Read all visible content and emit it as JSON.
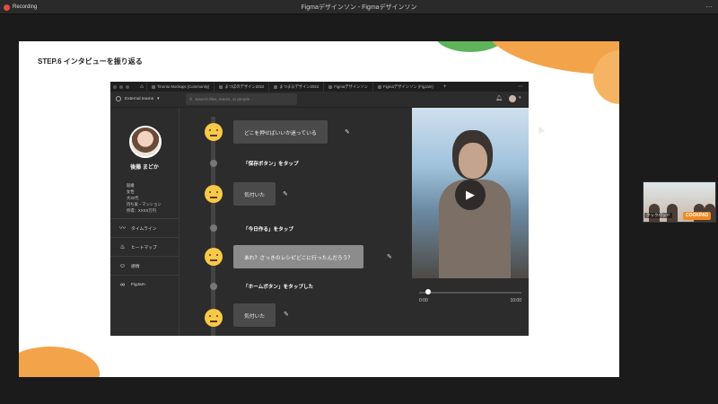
{
  "window": {
    "recording_label": "Recording",
    "title": "Figmaデザインソン - Figmaデザインソン"
  },
  "slide": {
    "title": "STEP.6 インタビューを振り返る"
  },
  "figma": {
    "tabs": [
      "Tinonto Mockups (Community)",
      "まつぼのデザイン2022",
      "まつまるデザイン2022",
      "Figmaデザインソン",
      "Figmaデザインソン (FigJam)"
    ],
    "team_label": "External teams",
    "search_placeholder": "Search files, teams, or people"
  },
  "persona": {
    "name": "後藤 まどか",
    "attributes": [
      "既婚",
      "女性",
      "大30代",
      "持ち家・マンション",
      "所得：XXXX万円"
    ],
    "menu": [
      {
        "label": "タイムライン",
        "icon": "timeline-icon"
      },
      {
        "label": "ヒートマップ",
        "icon": "flame-icon"
      },
      {
        "label": "感情",
        "icon": "smiley-icon"
      },
      {
        "label": "FigJam",
        "icon": "link-icon"
      }
    ]
  },
  "timeline": {
    "events": [
      {
        "emoji": "crying-face-icon",
        "bubble": "どこを押せばいいか迷っている"
      },
      {
        "action": "「保存ボタン」をタップ"
      },
      {
        "emoji": "neutral-face-icon",
        "bubble": "気付いた"
      },
      {
        "action": "「今日作る」をタップ"
      },
      {
        "emoji": "confused-face-icon",
        "bubble": "あれ？さっきのレシピどこに行ったんだろう？"
      },
      {
        "action": "「ホームボタン」をタップした"
      },
      {
        "emoji": "neutral-face-icon",
        "bubble": "気付いた"
      }
    ]
  },
  "video": {
    "time_start": "0:00",
    "time_end": "10:00",
    "progress": 0.09
  },
  "participant": {
    "label": "クックパッド",
    "logo": "COOKPAD"
  },
  "colors": {
    "accent_orange": "#f3a34a",
    "accent_green": "#5fb35b",
    "emoji_yellow": "#f7c948",
    "figma_dark": "#2c2c2c"
  }
}
